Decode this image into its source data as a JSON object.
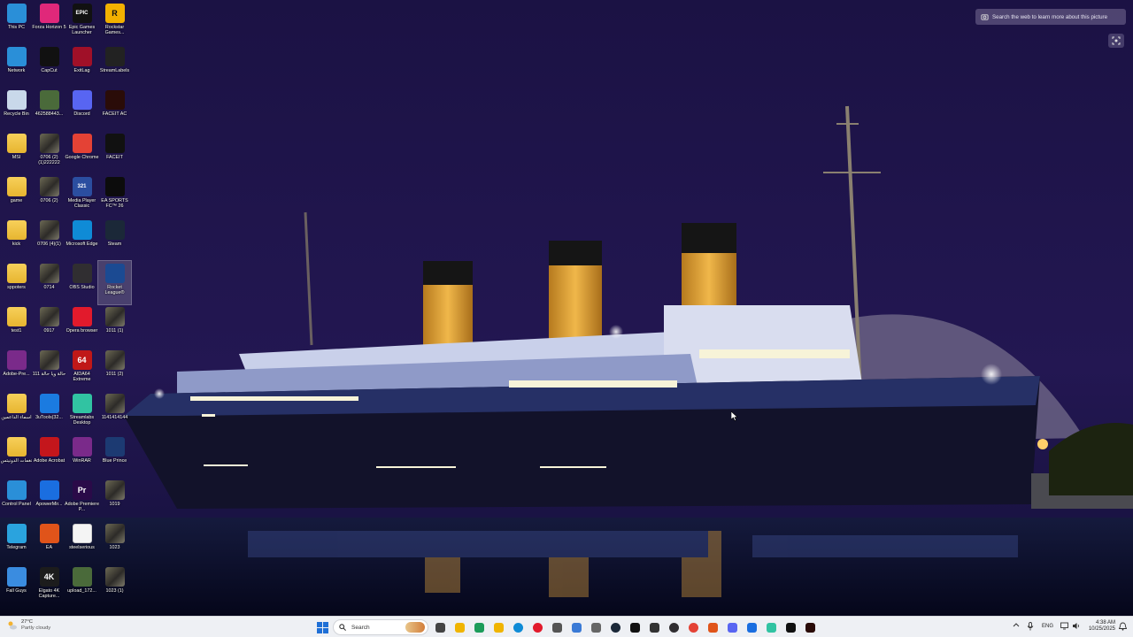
{
  "desktop": {
    "icons": [
      {
        "label": "This PC",
        "icon": "this-pc-icon"
      },
      {
        "label": "Forza Horizon 5",
        "icon": "forza-horizon-5-icon"
      },
      {
        "label": "Epic Games Launcher",
        "icon": "epic-games-icon",
        "glyph": "EPIC"
      },
      {
        "label": "Rockstar Games...",
        "icon": "rockstar-games-icon",
        "glyph": "R"
      },
      {
        "label": "Network",
        "icon": "network-icon"
      },
      {
        "label": "CapCut",
        "icon": "capcut-icon"
      },
      {
        "label": "ExitLag",
        "icon": "exitlag-icon"
      },
      {
        "label": "StreamLabels",
        "icon": "streamlabels-icon"
      },
      {
        "label": "Recycle Bin",
        "icon": "recycle-bin-icon"
      },
      {
        "label": "462588443...",
        "icon": "image-thumbnail-icon"
      },
      {
        "label": "Discord",
        "icon": "discord-icon"
      },
      {
        "label": "FACEIT AC",
        "icon": "faceit-ac-icon"
      },
      {
        "label": "MSI",
        "icon": "folder-icon"
      },
      {
        "label": "0706 (2)(1)222222",
        "icon": "video-thumbnail-icon"
      },
      {
        "label": "Google Chrome",
        "icon": "google-chrome-icon"
      },
      {
        "label": "FACEIT",
        "icon": "faceit-icon"
      },
      {
        "label": "game",
        "icon": "folder-icon"
      },
      {
        "label": "0706 (2)",
        "icon": "video-thumbnail-icon"
      },
      {
        "label": "Media Player Classic",
        "icon": "media-player-classic-icon",
        "glyph": "321"
      },
      {
        "label": "EA SPORTS FC™ 26",
        "icon": "ea-sports-fc-icon"
      },
      {
        "label": "kick",
        "icon": "folder-icon"
      },
      {
        "label": "0706 (4)(1)",
        "icon": "video-thumbnail-icon"
      },
      {
        "label": "Microsoft Edge",
        "icon": "microsoft-edge-icon"
      },
      {
        "label": "Steam",
        "icon": "steam-icon"
      },
      {
        "label": "sppoters",
        "icon": "folder-icon"
      },
      {
        "label": "0714",
        "icon": "video-thumbnail-icon"
      },
      {
        "label": "OBS Studio",
        "icon": "obs-studio-icon"
      },
      {
        "label": "Rocket League®",
        "icon": "rocket-league-icon"
      },
      {
        "label": "test1",
        "icon": "folder-icon"
      },
      {
        "label": "0917",
        "icon": "video-thumbnail-icon"
      },
      {
        "label": "Opera browser",
        "icon": "opera-icon"
      },
      {
        "label": "1011 (1)",
        "icon": "video-thumbnail-icon"
      },
      {
        "label": "Adobe-Pre...",
        "icon": "winrar-archive-icon"
      },
      {
        "label": "حالة ويا حالة 111",
        "icon": "video-thumbnail-icon"
      },
      {
        "label": "AIDA64 Extreme",
        "icon": "aida64-icon",
        "glyph": "64"
      },
      {
        "label": "1011 (2)",
        "icon": "video-thumbnail-icon"
      },
      {
        "label": "اسماء الداعمين",
        "icon": "folder-icon"
      },
      {
        "label": "3uTools(32...",
        "icon": "3utools-icon"
      },
      {
        "label": "Streamlabs Desktop",
        "icon": "streamlabs-icon"
      },
      {
        "label": "1141414144",
        "icon": "video-thumbnail-icon"
      },
      {
        "label": "نغمات الدونيتس",
        "icon": "folder-icon"
      },
      {
        "label": "Adobe Acrobat",
        "icon": "adobe-acrobat-icon"
      },
      {
        "label": "WinRAR",
        "icon": "winrar-icon"
      },
      {
        "label": "Blue Prince",
        "icon": "blue-prince-icon"
      },
      {
        "label": "Control Panel",
        "icon": "control-panel-icon"
      },
      {
        "label": "ApowerMir...",
        "icon": "apowermirror-icon"
      },
      {
        "label": "Adobe Premiere P...",
        "icon": "adobe-premiere-icon",
        "glyph": "Pr"
      },
      {
        "label": "1019",
        "icon": "video-thumbnail-icon"
      },
      {
        "label": "Telegram",
        "icon": "telegram-icon"
      },
      {
        "label": "EA",
        "icon": "ea-icon"
      },
      {
        "label": "steelserious",
        "icon": "text-file-icon"
      },
      {
        "label": "1023",
        "icon": "video-thumbnail-icon"
      },
      {
        "label": "Fall Guys",
        "icon": "fall-guys-icon"
      },
      {
        "label": "Elgato 4K Capture...",
        "icon": "elgato-4k-icon",
        "glyph": "4K"
      },
      {
        "label": "upload_172...",
        "icon": "image-thumbnail-icon"
      },
      {
        "label": "1023 (1)",
        "icon": "video-thumbnail-icon"
      }
    ],
    "selected_label": "Rocket League®"
  },
  "spotlight": {
    "search_text": "Search the web to learn more about this picture"
  },
  "taskbar": {
    "weather_temp": "27°C",
    "weather_desc": "Partly cloudy",
    "search_placeholder": "Search",
    "language": "ENG",
    "time": "4:38 AM",
    "date": "10/25/2025",
    "pinned_icons": [
      "task-view-icon",
      "file-explorer-icon",
      "excel-like-app-icon",
      "folder-icon",
      "edge-icon",
      "opera-icon",
      "calculator-icon",
      "photos-icon",
      "settings-icon",
      "steam-icon",
      "capcut-icon",
      "terminal-icon",
      "obs-icon",
      "chrome-icon",
      "ea-icon",
      "discord-icon",
      "apowermirror-icon",
      "streamlabs-icon",
      "faceit-icon",
      "faceit-ac-icon"
    ]
  },
  "colors": {
    "sky": "#1b1244",
    "water": "#0a0d2a",
    "hull": "#12122a",
    "funnel_black": "#1a1a1a",
    "funnel_gold": "#e3a93a",
    "taskbar_bg": "#eef0f4"
  }
}
